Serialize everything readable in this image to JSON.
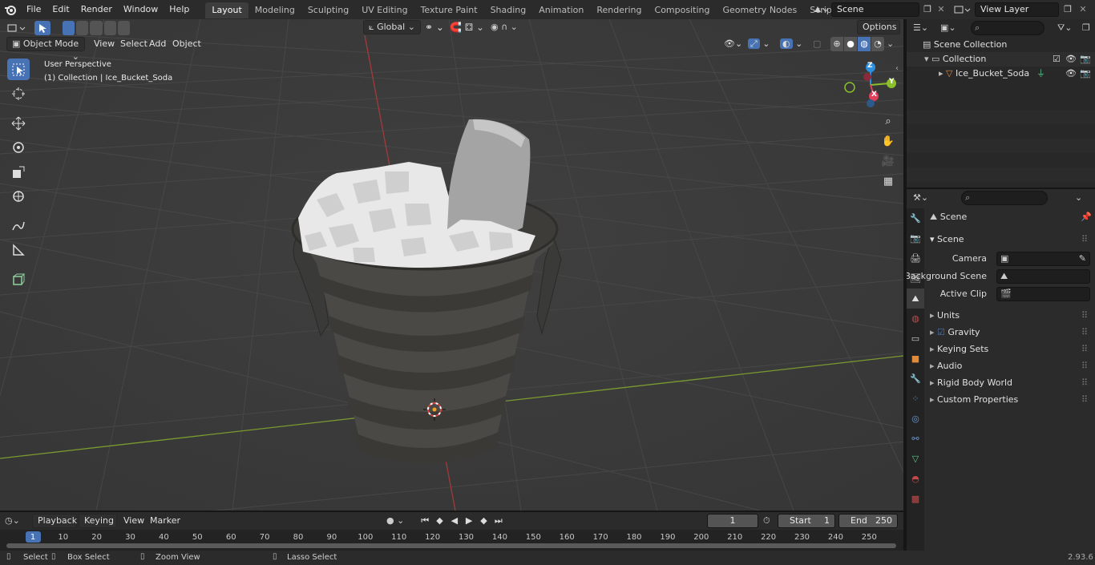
{
  "topbar": {
    "menus": [
      "File",
      "Edit",
      "Render",
      "Window",
      "Help"
    ],
    "tabs": [
      "Layout",
      "Modeling",
      "Sculpting",
      "UV Editing",
      "Texture Paint",
      "Shading",
      "Animation",
      "Rendering",
      "Compositing",
      "Geometry Nodes",
      "Scripting"
    ],
    "add_tab": "+",
    "scene_field": "Scene",
    "view_layer_field": "View Layer"
  },
  "viewport": {
    "mode": "Object Mode",
    "menus": [
      "View",
      "Select",
      "Add",
      "Object"
    ],
    "transform_orientation": "Global",
    "options": "Options",
    "overlay_title": "User Perspective",
    "overlay_subtitle": "(1) Collection | Ice_Bucket_Soda",
    "gizmo_axes": {
      "x": "X",
      "y": "Y",
      "z": "Z"
    }
  },
  "outliner": {
    "scene_collection": "Scene Collection",
    "collection": "Collection",
    "object": "Ice_Bucket_Soda"
  },
  "properties": {
    "header": "Scene",
    "panel": "Scene",
    "camera_label": "Camera",
    "background_scene_label": "Background Scene",
    "active_clip_label": "Active Clip",
    "subpanels": [
      "Units",
      "Gravity",
      "Keying Sets",
      "Audio",
      "Rigid Body World",
      "Custom Properties"
    ]
  },
  "timeline": {
    "menus": [
      "Playback",
      "Keying",
      "View",
      "Marker"
    ],
    "current_frame": "1",
    "start_label": "Start",
    "start": "1",
    "end_label": "End",
    "end": "250",
    "ticks": [
      "1",
      "10",
      "20",
      "30",
      "40",
      "50",
      "60",
      "70",
      "80",
      "90",
      "100",
      "110",
      "120",
      "130",
      "140",
      "150",
      "160",
      "170",
      "180",
      "190",
      "200",
      "210",
      "220",
      "230",
      "240",
      "250"
    ]
  },
  "statusbar": {
    "select": "Select",
    "box_select": "Box Select",
    "zoom_view": "Zoom View",
    "lasso_select": "Lasso Select",
    "version": "2.93.6"
  },
  "colors": {
    "accent": "#4772b3",
    "x_axis": "#e0405a",
    "y_axis": "#8bc02a",
    "z_axis": "#2c8fe0"
  }
}
